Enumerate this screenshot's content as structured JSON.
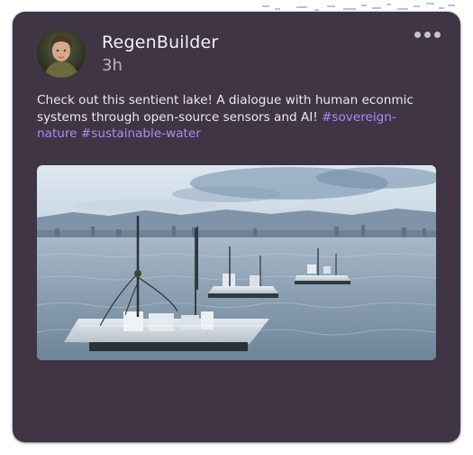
{
  "post": {
    "author": "RegenBuilder",
    "time": "3h",
    "text": "Check out this sentient lake! A dialogue with human econmic systems through open-source sensors and AI!",
    "hashtags": [
      "#sovereign-nature",
      "#sustainable-water"
    ]
  },
  "icons": {
    "menu": "more-options-icon",
    "avatar": "user-avatar"
  },
  "colors": {
    "card_bg": "#3f3545",
    "hashtag": "#a98df0",
    "text": "#ece8ef"
  }
}
